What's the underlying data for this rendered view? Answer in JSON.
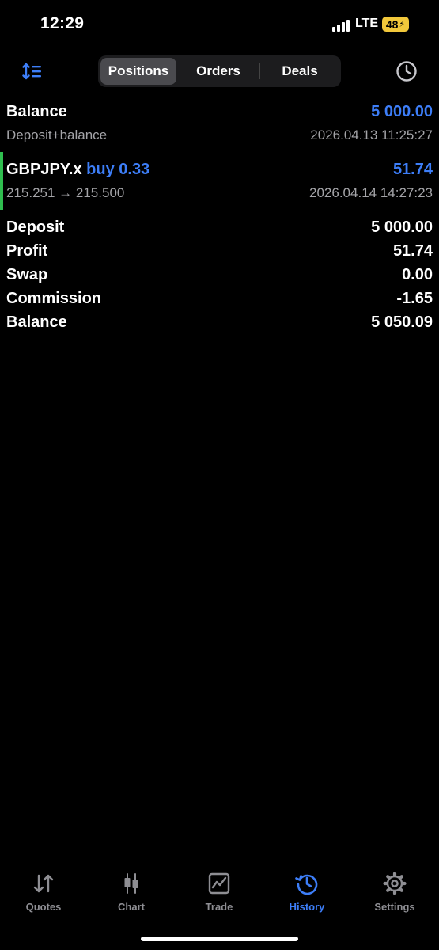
{
  "status_bar": {
    "time": "12:29",
    "network": "LTE",
    "battery": "48"
  },
  "segments": {
    "positions": "Positions",
    "orders": "Orders",
    "deals": "Deals",
    "selected": "Positions"
  },
  "balance_row": {
    "title": "Balance",
    "amount": "5 000.00",
    "subtitle": "Deposit+balance",
    "timestamp": "2026.04.13 11:25:27"
  },
  "position_row": {
    "symbol": "GBPJPY.x",
    "direction": "buy 0.33",
    "profit": "51.74",
    "prices": "215.251 → 215.500",
    "timestamp": "2026.04.14 14:27:23"
  },
  "summary": [
    {
      "label": "Deposit",
      "value": "5 000.00"
    },
    {
      "label": "Profit",
      "value": "51.74"
    },
    {
      "label": "Swap",
      "value": "0.00"
    },
    {
      "label": "Commission",
      "value": "-1.65"
    },
    {
      "label": "Balance",
      "value": "5 050.09"
    }
  ],
  "tabs": [
    {
      "label": "Quotes",
      "icon": "quotes-icon"
    },
    {
      "label": "Chart",
      "icon": "chart-icon"
    },
    {
      "label": "Trade",
      "icon": "trade-icon"
    },
    {
      "label": "History",
      "icon": "history-icon",
      "active": true
    },
    {
      "label": "Settings",
      "icon": "settings-icon"
    }
  ],
  "colors": {
    "accent": "#3d7ef8",
    "buy_marker": "#2fbe4f",
    "battery": "#f2c83b"
  }
}
